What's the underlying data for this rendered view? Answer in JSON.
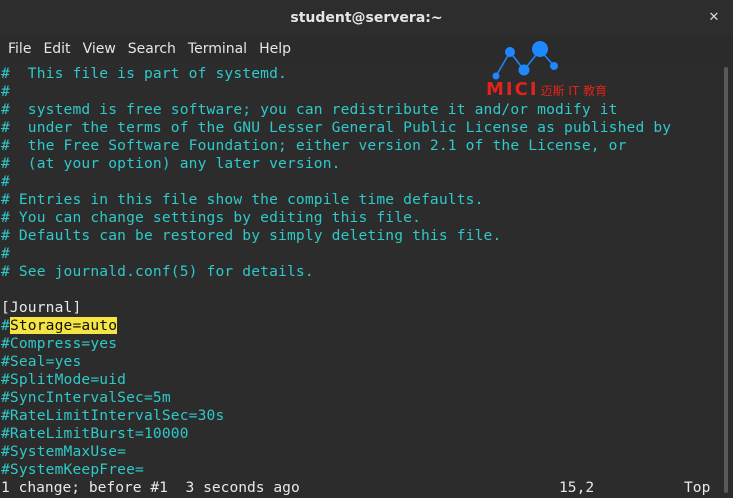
{
  "window": {
    "title": "student@servera:~",
    "close_glyph": "✕"
  },
  "menu": [
    "File",
    "Edit",
    "View",
    "Search",
    "Terminal",
    "Help"
  ],
  "editor": {
    "lines": [
      "#  This file is part of systemd.",
      "#",
      "#  systemd is free software; you can redistribute it and/or modify it",
      "#  under the terms of the GNU Lesser General Public License as published by",
      "#  the Free Software Foundation; either version 2.1 of the License, or",
      "#  (at your option) any later version.",
      "#",
      "# Entries in this file show the compile time defaults.",
      "# You can change settings by editing this file.",
      "# Defaults can be restored by simply deleting this file.",
      "#",
      "# See journald.conf(5) for details.",
      "",
      "[Journal]",
      "#Storage=auto",
      "#Compress=yes",
      "#Seal=yes",
      "#SplitMode=uid",
      "#SyncIntervalSec=5m",
      "#RateLimitIntervalSec=30s",
      "#RateLimitBurst=10000",
      "#SystemMaxUse=",
      "#SystemKeepFree="
    ],
    "highlight": {
      "prefix": "#",
      "text": "Storage=auto"
    },
    "colors": {
      "comment": "#2fc9c9",
      "plain": "#e8e8e8",
      "highlight_bg": "#f5e444",
      "background": "#2c2c2c"
    }
  },
  "status": {
    "message": "1 change; before #1  3 seconds ago",
    "position": "15,2",
    "scroll": "Top"
  },
  "watermark": {
    "brand": "MICI",
    "subtitle": "迈斯 IT 教育",
    "color": "#e0241b",
    "node_color": "#1e88ff"
  }
}
